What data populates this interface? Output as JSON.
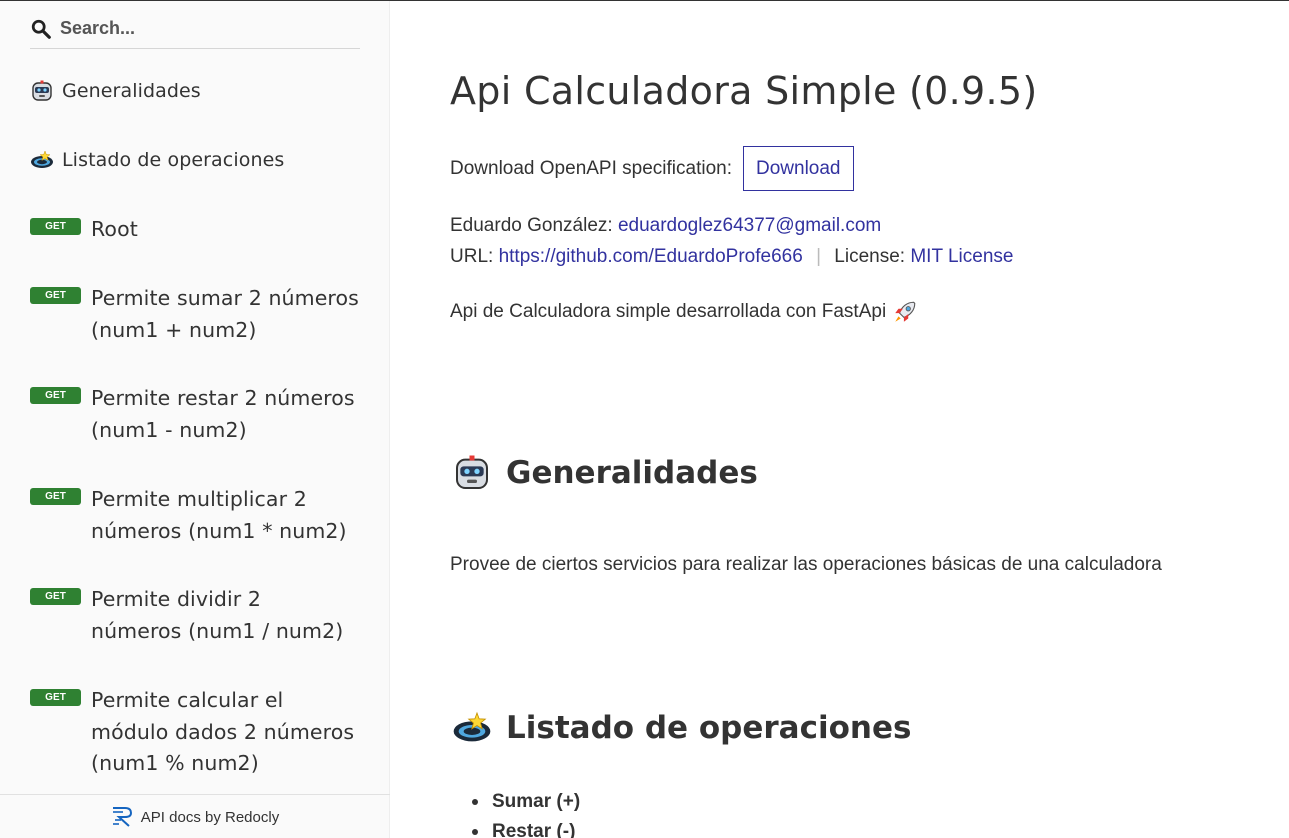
{
  "search": {
    "placeholder": "Search..."
  },
  "sidebar": {
    "items": [
      {
        "type": "group",
        "icon": "robot-icon",
        "label": "Generalidades"
      },
      {
        "type": "group",
        "icon": "planet-icon",
        "label": "Listado de operaciones"
      },
      {
        "type": "op",
        "method": "GET",
        "label": "Root"
      },
      {
        "type": "op",
        "method": "GET",
        "label": "Permite sumar 2 números (num1 + num2)"
      },
      {
        "type": "op",
        "method": "GET",
        "label": "Permite restar 2 números (num1 - num2)"
      },
      {
        "type": "op",
        "method": "GET",
        "label": "Permite multiplicar 2 números (num1 * num2)"
      },
      {
        "type": "op",
        "method": "GET",
        "label": "Permite dividir 2 números (num1 / num2)"
      },
      {
        "type": "op",
        "method": "GET",
        "label": "Permite calcular el módulo dados 2 números (num1 % num2)"
      }
    ],
    "footer": "API docs by Redocly"
  },
  "main": {
    "title": "Api Calculadora Simple (0.9.5)",
    "download_prefix": "Download OpenAPI specification:",
    "download_label": "Download",
    "contact_prefix": "Eduardo González:",
    "contact_email": "eduardoglez64377@gmail.com",
    "url_prefix": "URL:",
    "url": "https://github.com/EduardoProfe666",
    "separator": "|",
    "license_prefix": "License:",
    "license": "MIT License",
    "description": "Api de Calculadora simple desarrollada con FastApi",
    "section1_title": "Generalidades",
    "section1_text": "Provee de ciertos servicios para realizar las operaciones básicas de una calculadora",
    "section2_title": "Listado de operaciones",
    "operations": [
      "Sumar (+)",
      "Restar (-)"
    ]
  },
  "colors": {
    "link": "#32329f",
    "get_badge": "#2f8132",
    "sidebar_bg": "#fafafa"
  }
}
